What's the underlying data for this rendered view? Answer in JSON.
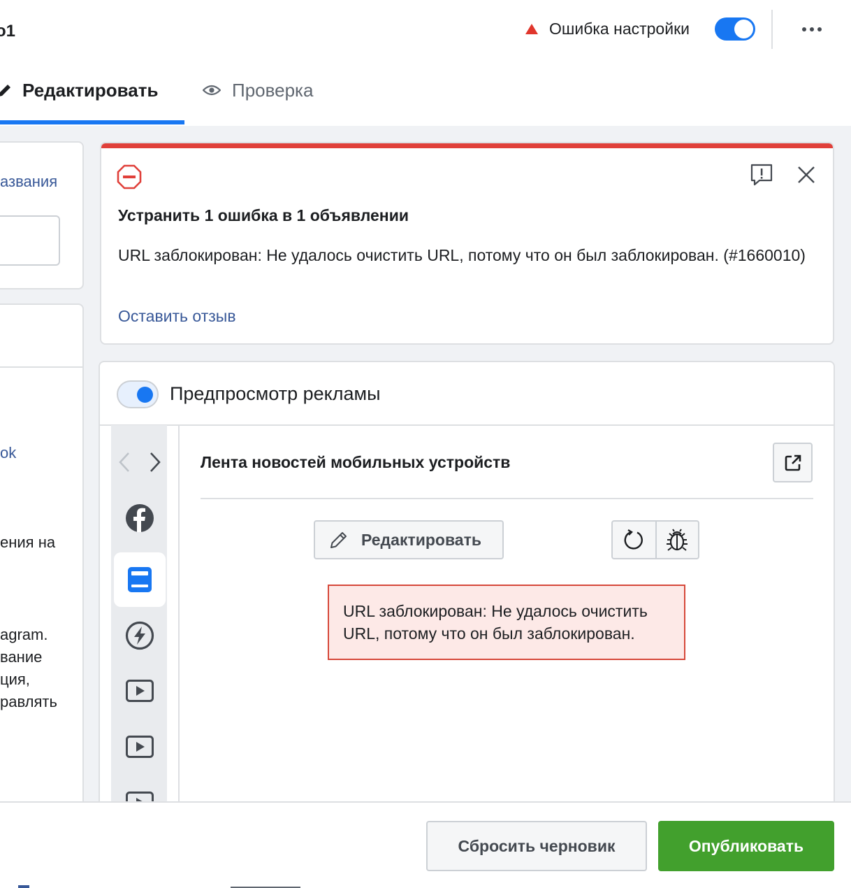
{
  "header": {
    "ad_name": "o1",
    "status_text": "Ошибка настройки",
    "tabs": [
      {
        "label": "Редактировать"
      },
      {
        "label": "Проверка"
      }
    ]
  },
  "left_panel": {
    "name_link": "азвания",
    "link_fragment": "ok",
    "text_fragment": "ения на",
    "paragraph_lines": [
      "agram.",
      "вание",
      "ция,",
      "равлять"
    ]
  },
  "error_card": {
    "title": "Устранить 1 ошибка в 1 объявлении",
    "message": "URL заблокирован: Не удалось очистить URL, потому что он был заблокирован. (#1660010)",
    "feedback_link": "Оставить отзыв"
  },
  "preview": {
    "toggle_label": "Предпросмотр рекламы",
    "placement_title": "Лента новостей мобильных устройств",
    "edit_button": "Редактировать",
    "error_text": "URL заблокирован: Не удалось очистить URL, потому что он был заблокирован."
  },
  "footer": {
    "reset_button": "Сбросить черновик",
    "publish_button": "Опубликовать"
  },
  "colors": {
    "accent": "#1877f2",
    "error": "#e0403a",
    "publish": "#42a02d",
    "link": "#385898"
  },
  "icons": [
    "pencil-icon",
    "eye-icon",
    "warning-triangle-icon",
    "more-icon",
    "error-stop-icon",
    "report-feedback-icon",
    "close-icon",
    "chevron-left-icon",
    "chevron-right-icon",
    "facebook-icon",
    "mobile-feed-icon",
    "lightning-icon",
    "video-icon",
    "external-link-icon",
    "refresh-icon",
    "bug-icon"
  ]
}
